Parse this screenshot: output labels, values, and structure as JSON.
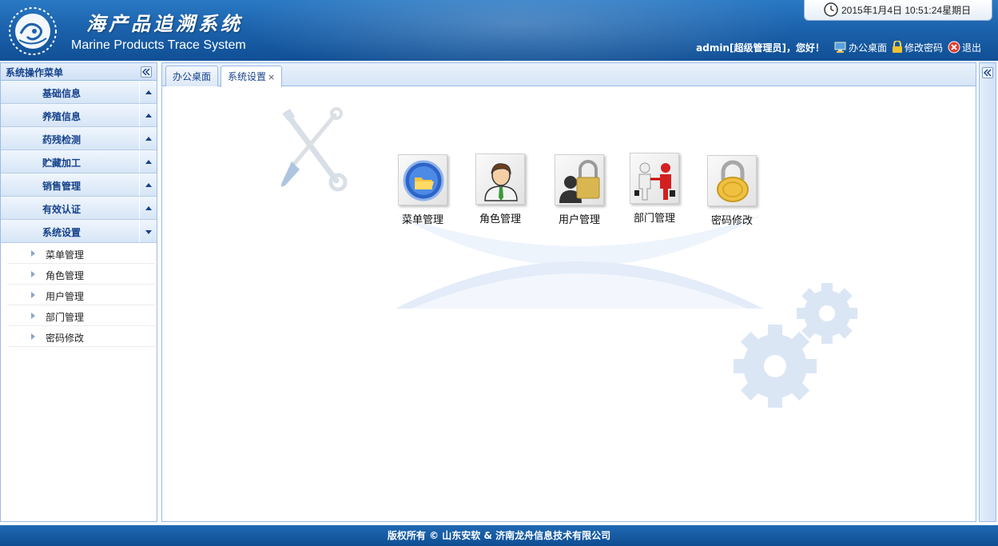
{
  "header": {
    "title_cn": "海产品追溯系统",
    "title_en": "Marine Products Trace System",
    "datetime": "2015年1月4日  10:51:24星期日",
    "greeting": "admin[超级管理员]，您好！",
    "links": [
      {
        "label": "办公桌面",
        "icon": "desktop-icon"
      },
      {
        "label": "修改密码",
        "icon": "lock-icon"
      },
      {
        "label": "退出",
        "icon": "exit-icon"
      }
    ]
  },
  "sidebar": {
    "title": "系统操作菜单",
    "menus": [
      {
        "label": "基础信息",
        "open": false
      },
      {
        "label": "养殖信息",
        "open": false
      },
      {
        "label": "药残检测",
        "open": false
      },
      {
        "label": "贮藏加工",
        "open": false
      },
      {
        "label": "销售管理",
        "open": false
      },
      {
        "label": "有效认证",
        "open": false
      },
      {
        "label": "系统设置",
        "open": true
      }
    ],
    "subitems": [
      {
        "label": "菜单管理"
      },
      {
        "label": "角色管理"
      },
      {
        "label": "用户管理"
      },
      {
        "label": "部门管理"
      },
      {
        "label": "密码修改"
      }
    ]
  },
  "tabs": [
    {
      "label": "办公桌面",
      "active": false
    },
    {
      "label": "系统设置",
      "active": true,
      "close": "×"
    }
  ],
  "tiles": [
    {
      "label": "菜单管理",
      "icon": "folder-globe-icon"
    },
    {
      "label": "角色管理",
      "icon": "user-avatar-icon"
    },
    {
      "label": "用户管理",
      "icon": "user-lock-icon"
    },
    {
      "label": "部门管理",
      "icon": "handshake-icon"
    },
    {
      "label": "密码修改",
      "icon": "gold-lock-icon"
    }
  ],
  "footer": {
    "text": "版权所有 © 山东安软 & 济南龙舟信息技术有限公司"
  },
  "colors": {
    "header": "#1c63ad",
    "menu_text": "#15428b",
    "border": "#99bbe8"
  }
}
